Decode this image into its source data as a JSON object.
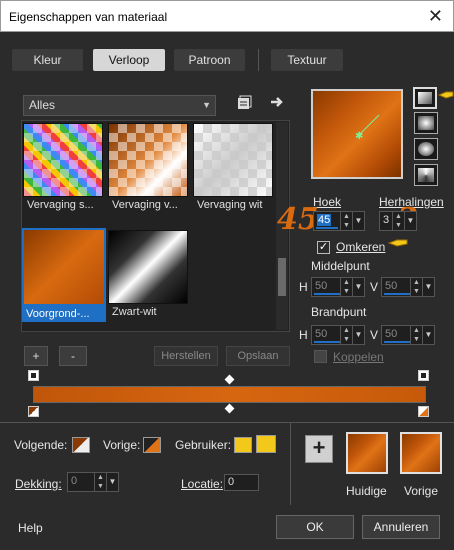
{
  "window": {
    "title": "Eigenschappen van materiaal",
    "close": "✕"
  },
  "tabs": [
    {
      "label": "Kleur",
      "active": false
    },
    {
      "label": "Verloop",
      "active": true
    },
    {
      "label": "Patroon",
      "active": false
    },
    {
      "label": "Textuur",
      "active": false
    }
  ],
  "gallery": {
    "filter_value": "Alles",
    "items": [
      {
        "label": "Vervaging s..."
      },
      {
        "label": "Vervaging v..."
      },
      {
        "label": "Vervaging wit"
      },
      {
        "label": "Voorgrond-...",
        "selected": true
      },
      {
        "label": "Zwart-wit"
      }
    ],
    "add_label": "+",
    "remove_label": "-",
    "reset_label": "Herstellen",
    "save_label": "Opslaan"
  },
  "settings": {
    "angle_label": "Hoek",
    "angle_value": "45",
    "repeats_label": "Herhalingen",
    "repeats_value": "3",
    "invert_label": "Omkeren",
    "invert_checked": true,
    "center_label": "Middelpunt",
    "center_h_label": "H",
    "center_h_value": "50",
    "center_v_label": "V",
    "center_v_value": "50",
    "focal_label": "Brandpunt",
    "focal_h_label": "H",
    "focal_h_value": "50",
    "focal_v_label": "V",
    "focal_v_value": "50",
    "link_label": "Koppelen",
    "link_checked": false
  },
  "annotations": {
    "angle": "45",
    "repeats": "3"
  },
  "gradient_editor": {
    "next_label": "Volgende:",
    "prev_label": "Vorige:",
    "user_label": "Gebruiker:",
    "opacity_label": "Dekking:",
    "opacity_value": "0",
    "location_label": "Locatie:",
    "location_value": "0"
  },
  "swatches": {
    "current_label": "Huidige",
    "previous_label": "Vorige",
    "add_label": "+"
  },
  "footer": {
    "help_label": "Help",
    "ok_label": "OK",
    "cancel_label": "Annuleren"
  },
  "colors": {
    "accent": "#1f6fc5",
    "orange": "#d96a10",
    "user_yellow": "#f2c81a"
  }
}
